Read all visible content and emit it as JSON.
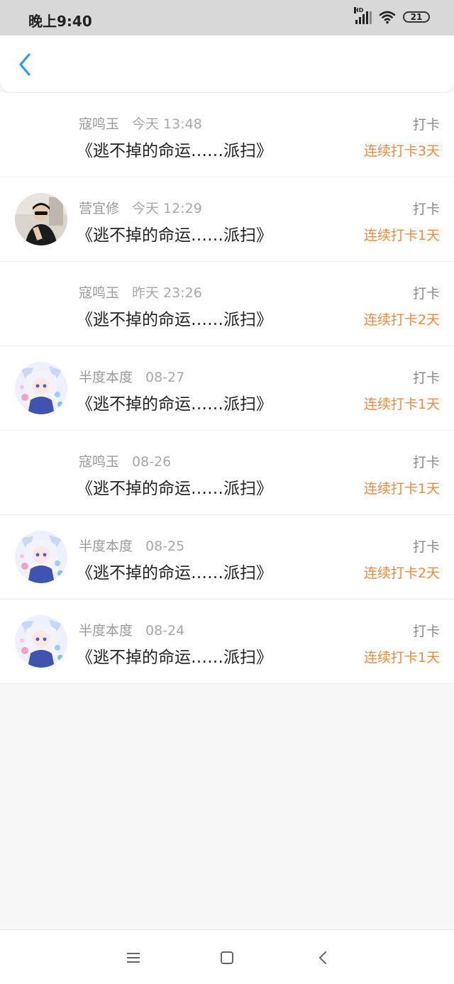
{
  "status_bar": {
    "time": "晚上9:40",
    "battery": "21",
    "icons": [
      "signal-hd-icon",
      "wifi-icon",
      "battery-icon"
    ]
  },
  "header": {
    "back_icon": "chevron-left-icon",
    "accent_color": "#2a9cf2"
  },
  "items": [
    {
      "name": "寇鸣玉",
      "time": "今天 13:48",
      "title": "《逃不掉的命运……派扫》",
      "action": "打卡",
      "streak": "连续打卡3天",
      "avatar": "none"
    },
    {
      "name": "营宜修",
      "time": "今天 12:29",
      "title": "《逃不掉的命运……派扫》",
      "action": "打卡",
      "streak": "连续打卡1天",
      "avatar": "photo"
    },
    {
      "name": "寇鸣玉",
      "time": "昨天 23:26",
      "title": "《逃不掉的命运……派扫》",
      "action": "打卡",
      "streak": "连续打卡2天",
      "avatar": "none"
    },
    {
      "name": "半度本度",
      "time": "08-27",
      "title": "《逃不掉的命运……派扫》",
      "action": "打卡",
      "streak": "连续打卡1天",
      "avatar": "anime"
    },
    {
      "name": "寇鸣玉",
      "time": "08-26",
      "title": "《逃不掉的命运……派扫》",
      "action": "打卡",
      "streak": "连续打卡1天",
      "avatar": "none"
    },
    {
      "name": "半度本度",
      "time": "08-25",
      "title": "《逃不掉的命运……派扫》",
      "action": "打卡",
      "streak": "连续打卡2天",
      "avatar": "anime"
    },
    {
      "name": "半度本度",
      "time": "08-24",
      "title": "《逃不掉的命运……派扫》",
      "action": "打卡",
      "streak": "连续打卡1天",
      "avatar": "anime"
    }
  ],
  "colors": {
    "streak": "#f08a3c",
    "name": "#9a9a9a",
    "title": "#222222",
    "background": "#f8f7f8"
  },
  "nav_bar": {
    "icons": [
      "menu-icon",
      "home-square-icon",
      "back-triangle-icon"
    ]
  }
}
